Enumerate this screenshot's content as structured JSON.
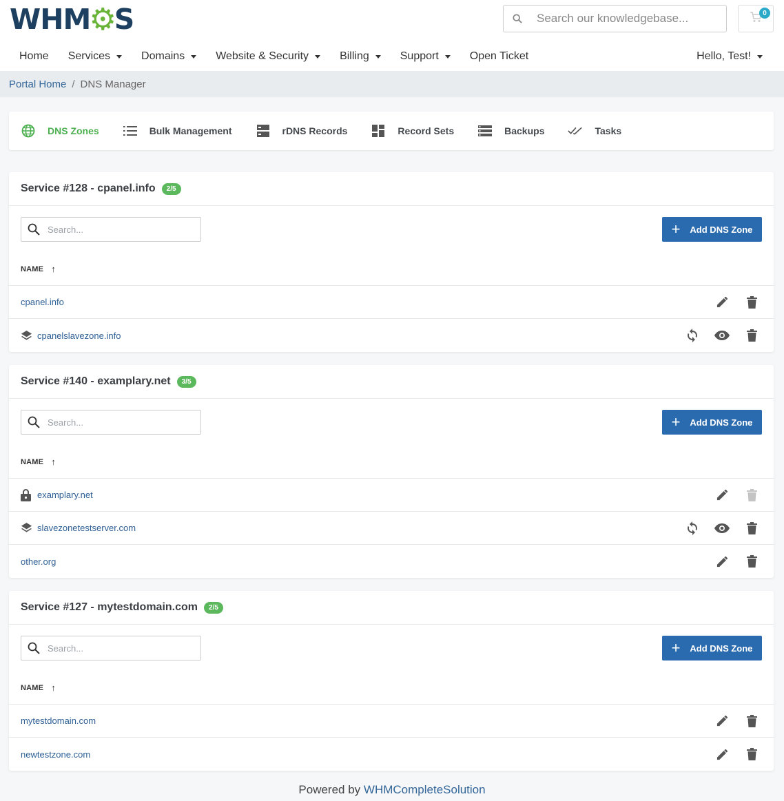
{
  "brand": {
    "logo_left": "WHM",
    "logo_right": "S",
    "logo_gear": "⚙"
  },
  "header": {
    "search_placeholder": "Search our knowledgebase...",
    "cart_count": "0"
  },
  "nav": {
    "items": [
      {
        "label": "Home",
        "dropdown": false
      },
      {
        "label": "Services",
        "dropdown": true
      },
      {
        "label": "Domains",
        "dropdown": true
      },
      {
        "label": "Website & Security",
        "dropdown": true
      },
      {
        "label": "Billing",
        "dropdown": true
      },
      {
        "label": "Support",
        "dropdown": true
      },
      {
        "label": "Open Ticket",
        "dropdown": false
      }
    ],
    "user_label": "Hello, Test!"
  },
  "breadcrumb": {
    "home": "Portal Home",
    "separator": "/",
    "current": "DNS Manager"
  },
  "tabs": [
    {
      "label": "DNS Zones",
      "icon": "globe-icon",
      "active": true
    },
    {
      "label": "Bulk Management",
      "icon": "list-icon",
      "active": false
    },
    {
      "label": "rDNS Records",
      "icon": "server-icon",
      "active": false
    },
    {
      "label": "Record Sets",
      "icon": "dashboard-icon",
      "active": false
    },
    {
      "label": "Backups",
      "icon": "storage-icon",
      "active": false
    },
    {
      "label": "Tasks",
      "icon": "double-check-icon",
      "active": false
    }
  ],
  "common": {
    "search_placeholder": "Search...",
    "add_button": "Add DNS Zone",
    "col_name": "NAME",
    "sort_arrow": "↑"
  },
  "services": [
    {
      "title": "Service #128 - cpanel.info",
      "badge": "2/5",
      "zones": [
        {
          "name": "cpanel.info",
          "icon": "",
          "actions": [
            "edit",
            "delete"
          ]
        },
        {
          "name": "cpanelslavezone.info",
          "icon": "layers-icon",
          "actions": [
            "sync",
            "view",
            "delete"
          ]
        }
      ]
    },
    {
      "title": "Service #140 - examplary.net",
      "badge": "3/5",
      "zones": [
        {
          "name": "examplary.net",
          "icon": "lock-icon",
          "actions": [
            "edit",
            "delete-disabled"
          ]
        },
        {
          "name": "slavezonetestserver.com",
          "icon": "layers-icon",
          "actions": [
            "sync",
            "view",
            "delete"
          ]
        },
        {
          "name": "other.org",
          "icon": "",
          "actions": [
            "edit",
            "delete"
          ]
        }
      ]
    },
    {
      "title": "Service #127 - mytestdomain.com",
      "badge": "2/5",
      "zones": [
        {
          "name": "mytestdomain.com",
          "icon": "",
          "actions": [
            "edit",
            "delete"
          ]
        },
        {
          "name": "newtestzone.com",
          "icon": "",
          "actions": [
            "edit",
            "delete"
          ]
        }
      ]
    }
  ],
  "footer": {
    "text": "Powered by ",
    "link": "WHMCompleteSolution"
  },
  "colors": {
    "accent_green": "#4caf50",
    "button_blue": "#2a6aae",
    "link_blue": "#2d5f95",
    "badge_green": "#5cb85c"
  }
}
